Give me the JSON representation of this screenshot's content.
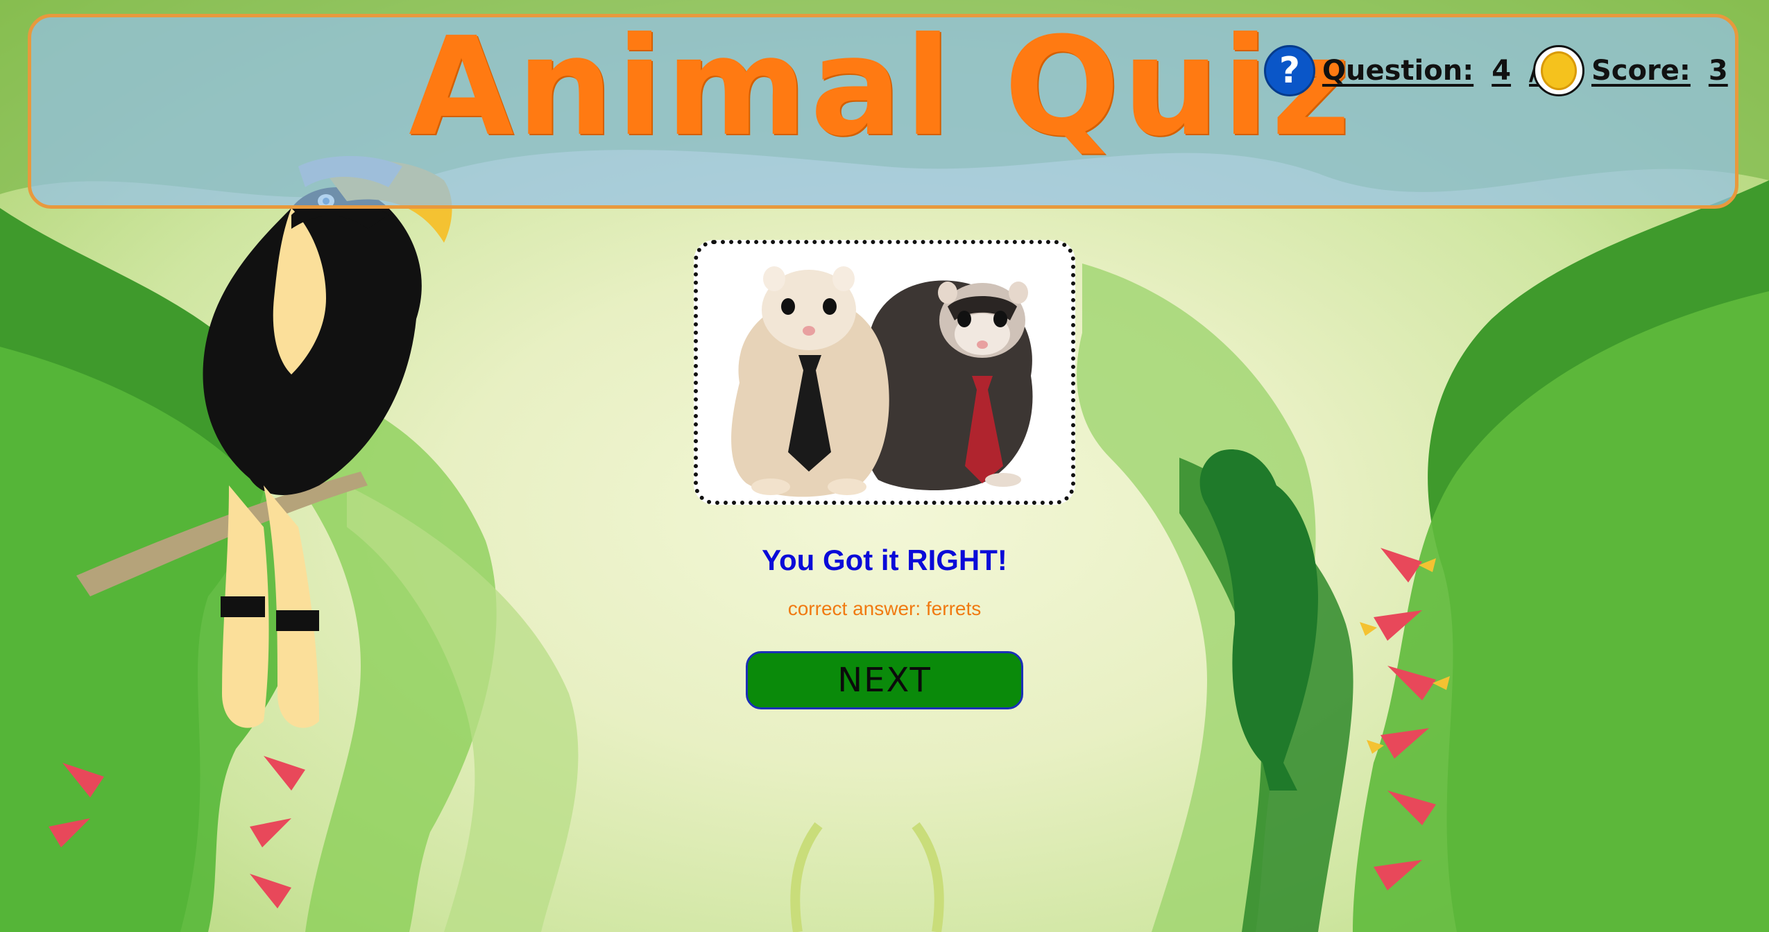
{
  "header": {
    "title": "Animal Quiz",
    "question_label": "Question:",
    "question_current": "4",
    "question_total": "/5",
    "score_label": "Score:",
    "score_value": "3",
    "question_icon": "question-mark-icon",
    "score_icon": "coin-icon"
  },
  "quiz": {
    "feedback": "You Got it RIGHT!",
    "correct_answer": "correct answer: ferrets",
    "next_label": "NEXT"
  },
  "colors": {
    "title": "#ff7a12",
    "header_border": "#e8993d",
    "feedback": "#0a0ad8",
    "answer": "#f07a12",
    "next_button": "#0a8a0a"
  }
}
